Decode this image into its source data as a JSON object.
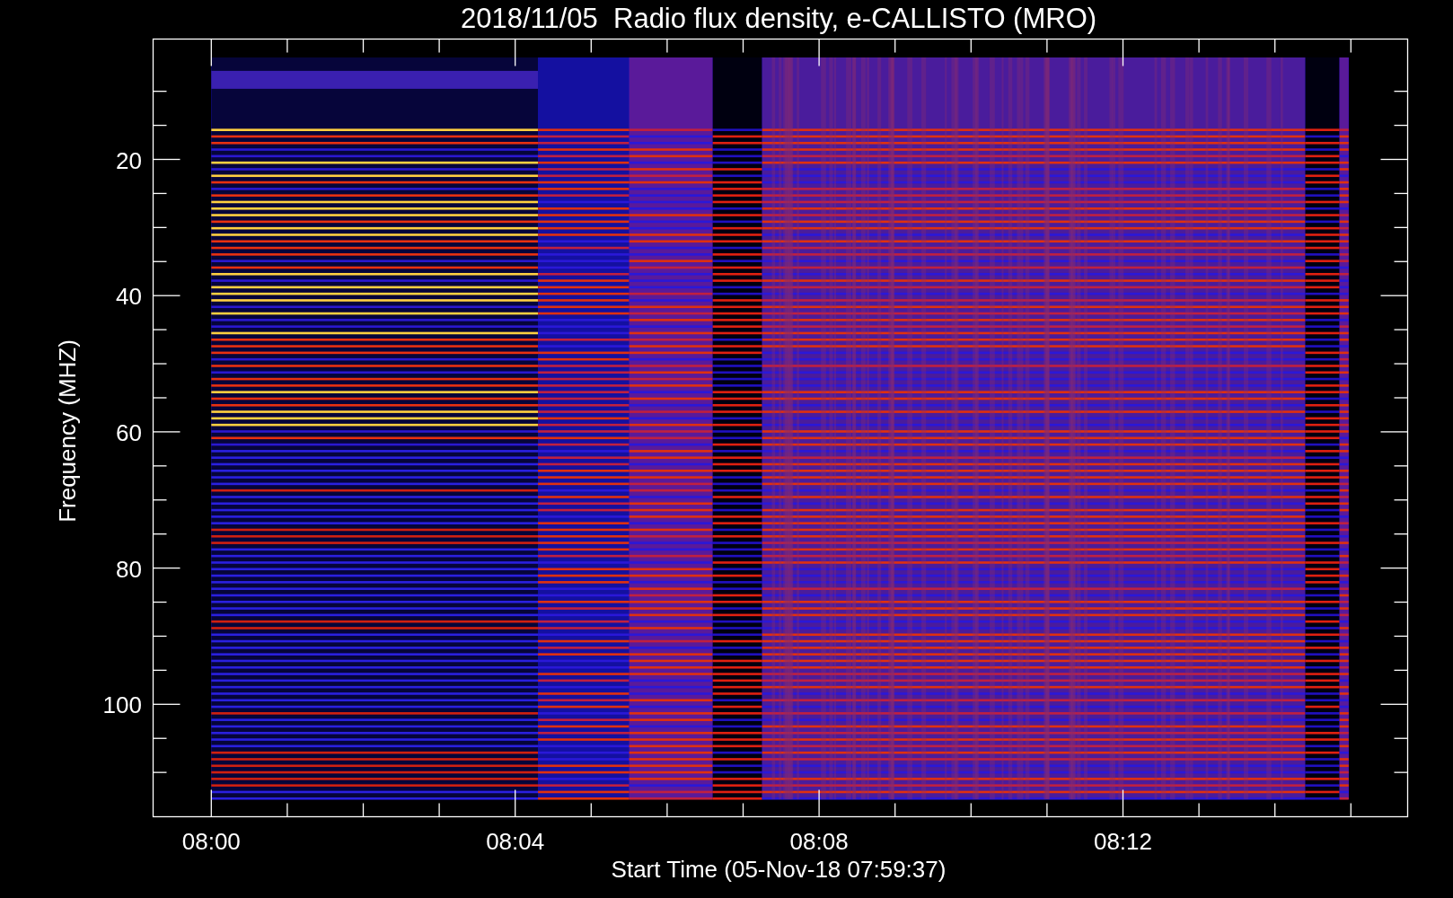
{
  "title": "2018/11/05  Radio flux density, e-CALLISTO (MRO)",
  "y_axis": {
    "label": "Frequency (MHZ)",
    "ticks": [
      "20",
      "40",
      "60",
      "80",
      "100"
    ]
  },
  "x_axis": {
    "label": "Start Time (05-Nov-18 07:59:37)",
    "ticks": [
      "08:00",
      "08:04",
      "08:08",
      "08:12"
    ]
  }
}
